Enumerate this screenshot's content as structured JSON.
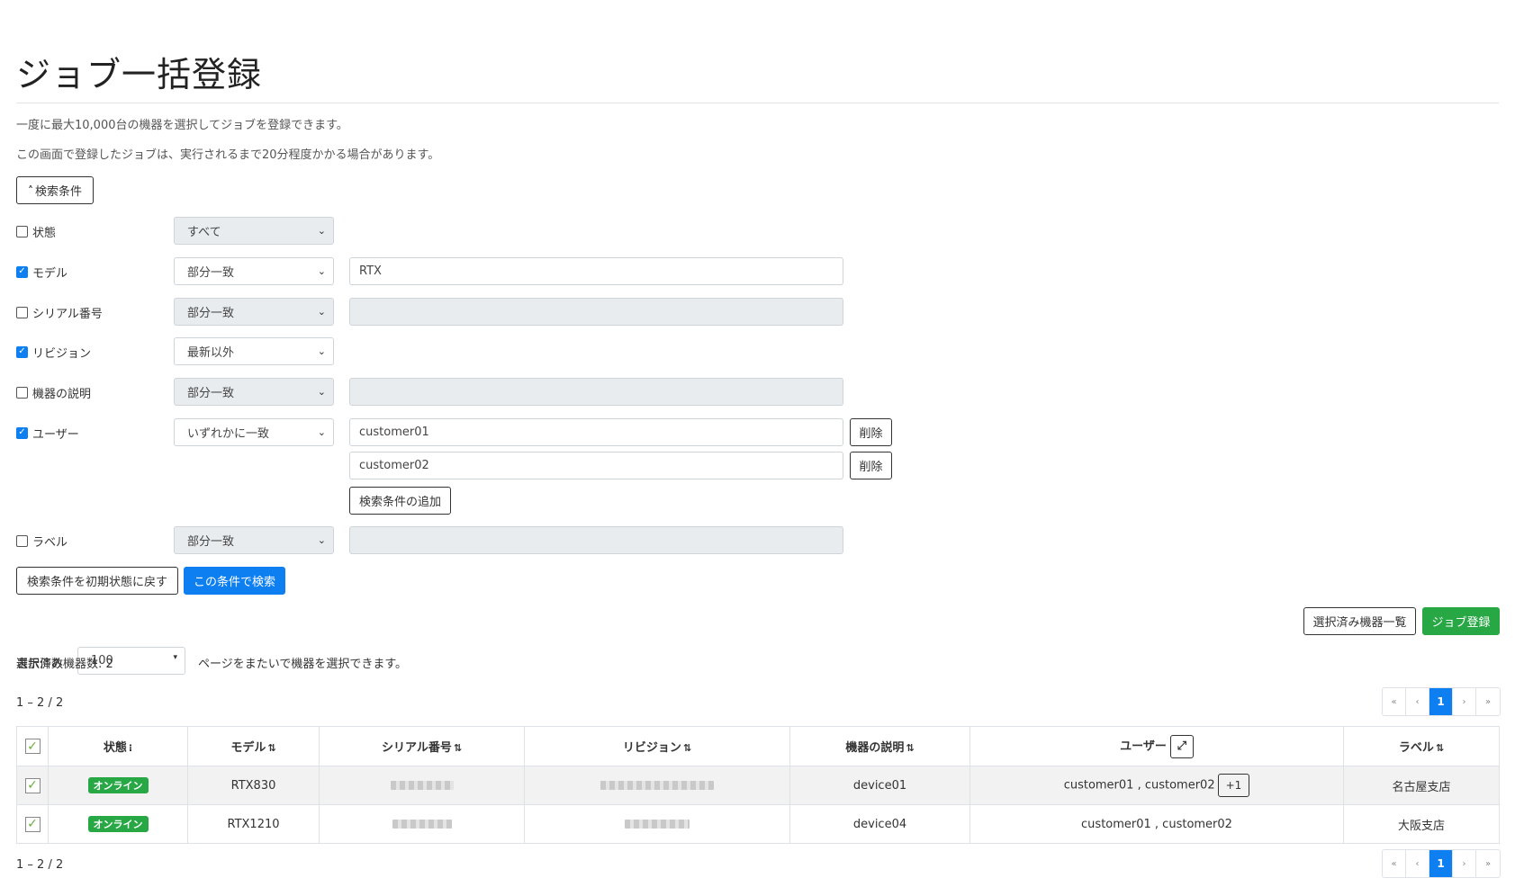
{
  "page": {
    "title": "ジョブ一括登録",
    "desc1": "一度に最大10,000台の機器を選択してジョブを登録できます。",
    "desc2": "この画面で登録したジョブは、実行されるまで20分程度かかる場合があります。"
  },
  "search": {
    "toggle_label": "検索条件",
    "conditions": {
      "status": {
        "label": "状態",
        "checked": false,
        "select": "すべて"
      },
      "model": {
        "label": "モデル",
        "checked": true,
        "select": "部分一致",
        "value": "RTX"
      },
      "serial": {
        "label": "シリアル番号",
        "checked": false,
        "select": "部分一致",
        "value": ""
      },
      "revision": {
        "label": "リビジョン",
        "checked": true,
        "select": "最新以外"
      },
      "description": {
        "label": "機器の説明",
        "checked": false,
        "select": "部分一致",
        "value": ""
      },
      "user": {
        "label": "ユーザー",
        "checked": true,
        "select": "いずれかに一致",
        "values": [
          "customer01",
          "customer02"
        ],
        "delete_label": "削除",
        "add_label": "検索条件の追加"
      },
      "label": {
        "label": "ラベル",
        "checked": false,
        "select": "部分一致",
        "value": ""
      }
    },
    "reset_label": "検索条件を初期状態に戻す",
    "search_label": "この条件で検索"
  },
  "actions": {
    "selected_list_label": "選択済み機器一覧",
    "register_label": "ジョブ登録"
  },
  "list": {
    "page_size_label": "表示件数",
    "page_size": "100",
    "cross_page_note": "ページをまたいで機器を選択できます。",
    "selected_count_label": "選択済み機器数: 2",
    "range_text": "1 – 2 / 2",
    "pager": {
      "first": "«",
      "prev": "‹",
      "current": "1",
      "next": "›",
      "last": "»"
    }
  },
  "table": {
    "headers": {
      "status": "状態",
      "model": "モデル",
      "serial": "シリアル番号",
      "revision": "リビジョン",
      "description": "機器の説明",
      "user": "ユーザー",
      "label": "ラベル"
    },
    "rows": [
      {
        "status": "オンライン",
        "model": "RTX830",
        "description": "device01",
        "user": "customer01 , customer02",
        "more": "+1",
        "label": "名古屋支店"
      },
      {
        "status": "オンライン",
        "model": "RTX1210",
        "description": "device04",
        "user": "customer01 , customer02",
        "label": "大阪支店"
      }
    ]
  },
  "icons": {
    "chevron_up": "˄",
    "check": "✓",
    "select_arrow": "⌄",
    "sort_list": "⁝",
    "sort_updown": "⇅",
    "expand": "⤢"
  },
  "colors": {
    "primary": "#0d7ff0",
    "success": "#28a745"
  }
}
